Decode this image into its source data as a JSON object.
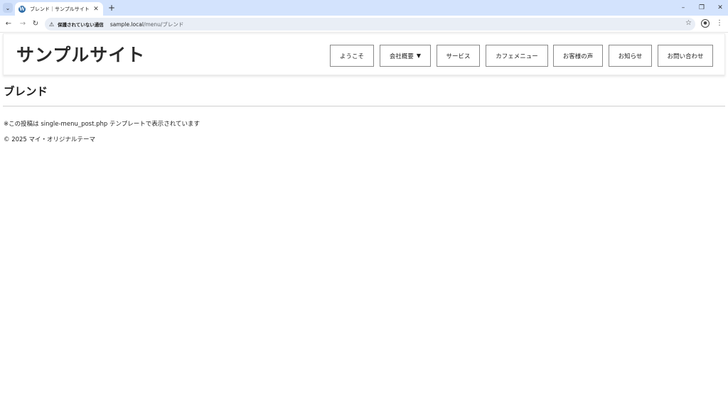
{
  "browser": {
    "tab": {
      "title": "ブレンド｜サンプルサイト",
      "favicon_glyph": "W",
      "close_glyph": "✕"
    },
    "tab_search_glyph": "⌄",
    "new_tab_glyph": "+",
    "window_controls": {
      "minimize": "–",
      "restore": "❐",
      "close": "✕"
    },
    "nav": {
      "back": "←",
      "forward": "→",
      "reload": "↻"
    },
    "security_icon": "⚠",
    "security_text": "保護されていない通信",
    "url_host": "sample.local",
    "url_path": "/menu/ブレンド",
    "star_glyph": "☆",
    "profile_glyph": "●",
    "menu_glyph": "⋮"
  },
  "site": {
    "title": "サンプルサイト",
    "nav": [
      {
        "label": "ようこそ"
      },
      {
        "label": "会社概要",
        "caret": "▼"
      },
      {
        "label": "サービス"
      },
      {
        "label": "カフェメニュー"
      },
      {
        "label": "お客様の声"
      },
      {
        "label": "お知らせ"
      },
      {
        "label": "お問い合わせ"
      }
    ]
  },
  "post": {
    "title": "ブレンド",
    "template_note": "※この投稿は single-menu_post.php テンプレートで表示されています"
  },
  "footer": {
    "copyright": "© 2025 マイ・オリジナルテーマ"
  },
  "colors": {
    "tabstrip": "#d3e3fd",
    "omnibox": "#e9eef6",
    "text": "#1f1f1f",
    "menu_border": "#8a8a8a"
  },
  "icons": {
    "tab_search": "chevron-down-icon",
    "favicon": "wordpress-icon",
    "security": "warning-icon",
    "bookmark": "star-icon",
    "profile": "profile-icon",
    "menu": "kebab-menu-icon"
  }
}
